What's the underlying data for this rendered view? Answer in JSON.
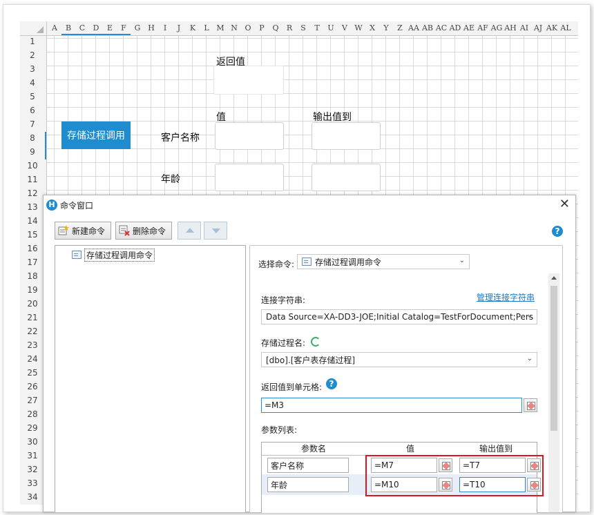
{
  "sheet": {
    "columns": [
      "A",
      "B",
      "C",
      "D",
      "E",
      "F",
      "G",
      "H",
      "I",
      "J",
      "K",
      "L",
      "M",
      "N",
      "O",
      "P",
      "Q",
      "R",
      "S",
      "T",
      "U",
      "V",
      "W",
      "X",
      "Y",
      "Z",
      "AA",
      "AB",
      "AC",
      "AD",
      "AE",
      "AF",
      "AG",
      "AH",
      "AI",
      "AJ",
      "AK",
      "AL"
    ],
    "rows": [
      "1",
      "2",
      "3",
      "4",
      "5",
      "6",
      "7",
      "8",
      "9",
      "10",
      "11",
      "12",
      "13",
      "14",
      "15",
      "16",
      "17",
      "18",
      "19",
      "20",
      "21",
      "22",
      "23",
      "24",
      "25",
      "26",
      "27",
      "28",
      "29",
      "30",
      "31",
      "32",
      "33",
      "34"
    ],
    "cells": {
      "return_value_label": "返回值",
      "value_label": "值",
      "output_to_label": "输出值到",
      "call_button": "存储过程调用",
      "customer_name_label": "客户名称",
      "age_label": "年龄"
    }
  },
  "dialog": {
    "title": "命令窗口",
    "logo_letter": "H",
    "close_glyph": "✕",
    "help_glyph": "?",
    "toolbar": {
      "new_command": "新建命令",
      "delete_command": "删除命令"
    },
    "tree": {
      "item": "存储过程调用命令"
    },
    "form": {
      "select_command_label": "选择命令:",
      "select_command_value": "存储过程调用命令",
      "connection_label": "连接字符串:",
      "manage_connection_link": "管理连接字符串",
      "connection_value": "Data Source=XA-DD3-JOE;Initial Catalog=TestForDocument;Pers",
      "procedure_label": "存储过程名:",
      "procedure_value": "[dbo].[客户表存储过程]",
      "return_cell_label": "返回值到单元格:",
      "return_cell_value": "=M3",
      "params_label": "参数列表:",
      "params_headers": [
        "参数名",
        "值",
        "输出值到"
      ],
      "params": [
        {
          "name": "客户名称",
          "value": "=M7",
          "output": "=T7"
        },
        {
          "name": "年龄",
          "value": "=M10",
          "output": "=T10"
        }
      ]
    }
  },
  "colors": {
    "accent": "#1f8ccf",
    "highlight_border": "#e0141f",
    "link": "#1f78c1"
  }
}
